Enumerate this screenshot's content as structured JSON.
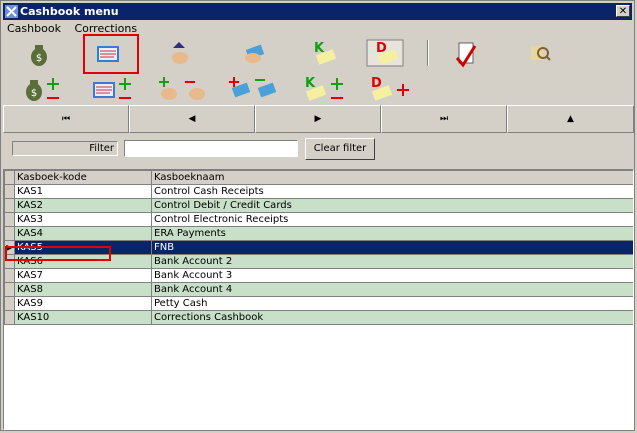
{
  "window": {
    "title": "Cashbook menu",
    "close_glyph": "✕"
  },
  "menu": {
    "items": [
      "Cashbook",
      "Corrections"
    ]
  },
  "toolbar": {
    "row1": [
      "money-bag-icon",
      "cashbook-book-icon",
      "up-hand-icon",
      "hand-card-icon",
      "ledger-k-icon",
      "ledger-d-icon",
      "report-chart-icon",
      "search-zoom-icon"
    ],
    "row2": [
      "money-bag-add-remove-icon",
      "cashbook-add-remove-icon",
      "hands-transfer-icon",
      "cards-transfer-icon",
      "ledger-k-add-remove-icon",
      "ledger-d-add-icon"
    ]
  },
  "nav": {
    "first": "⏮",
    "prev": "◀",
    "next": "▶",
    "last": "⏭",
    "up": "▲"
  },
  "filter": {
    "label": "Filter",
    "value": "",
    "clear_label": "Clear filter"
  },
  "grid": {
    "columns": [
      "Kasboek-kode",
      "Kasboeknaam"
    ],
    "selected_marker": "▶",
    "rows": [
      {
        "code": "KAS1",
        "name": "Control Cash Receipts"
      },
      {
        "code": "KAS2",
        "name": "Control Debit / Credit Cards"
      },
      {
        "code": "KAS3",
        "name": "Control Electronic Receipts"
      },
      {
        "code": "KAS4",
        "name": "ERA Payments"
      },
      {
        "code": "KAS5",
        "name": "FNB"
      },
      {
        "code": "KAS6",
        "name": "Bank Account 2"
      },
      {
        "code": "KAS7",
        "name": "Bank Account 3"
      },
      {
        "code": "KAS8",
        "name": "Bank Account 4"
      },
      {
        "code": "KAS9",
        "name": "Petty Cash"
      },
      {
        "code": "KAS10",
        "name": "Corrections Cashbook"
      }
    ],
    "selected_index": 4
  },
  "colors": {
    "title_bar": "#0a246a",
    "row_alt": "#c8dfc8",
    "highlight": "#e00000"
  }
}
